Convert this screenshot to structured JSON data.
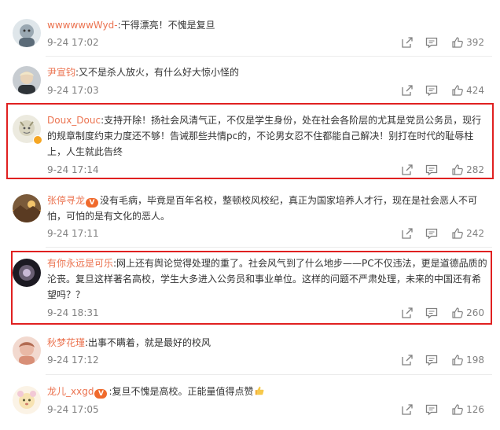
{
  "comments": [
    {
      "user": "wwwwwwWyd-",
      "text": ":干得漂亮！不愧是复旦",
      "time": "9-24 17:02",
      "likes": "392",
      "vip": false
    },
    {
      "user": "尹宣钧",
      "text": ":又不是杀人放火，有什么好大惊小怪的",
      "time": "9-24 17:03",
      "likes": "424",
      "vip": false
    },
    {
      "user": "Doux_Douc",
      "text": ":支持开除！扬社会风清气正，不仅是学生身份，处在社会各阶层的尤其是党员公务员，现行的规章制度约束力度还不够！告诫那些共情pc的，不论男女忍不住都能自己解决！别打在时代的耻辱柱上，人生就此告终",
      "time": "9-24 17:14",
      "likes": "282",
      "vip": false
    },
    {
      "user": "张停寻龙",
      "text": "没有毛病，毕竟是百年名校，整顿校风校纪，真正为国家培养人才行，现在是社会恶人不可怕，可怕的是有文化的恶人。",
      "time": "9-24 17:11",
      "likes": "242",
      "vip": true
    },
    {
      "user": "有你永远是可乐",
      "text": ":网上还有舆论觉得处理的重了。社会风气到了什么地步——PC不仅违法，更是道德品质的沦丧。复旦这样著名高校，学生大多进入公务员和事业单位。这样的问题不严肃处理，未来的中国还有希望吗？？",
      "time": "9-24 18:31",
      "likes": "260",
      "vip": false
    },
    {
      "user": "秋梦花瑾",
      "text": ":出事不瞒着，就是最好的校风",
      "time": "9-24 17:12",
      "likes": "198",
      "vip": false
    },
    {
      "user": "龙儿_xxgd",
      "text": ":复旦不愧是高校。正能量值得点赞",
      "time": "9-24 17:05",
      "likes": "126",
      "vip": true
    }
  ],
  "icons": {
    "share": "share-icon",
    "comment": "comment-icon",
    "like": "thumbs-up-icon"
  },
  "colors": {
    "username": "#eb7350",
    "highlight": "#e02020",
    "meta": "#808080"
  }
}
